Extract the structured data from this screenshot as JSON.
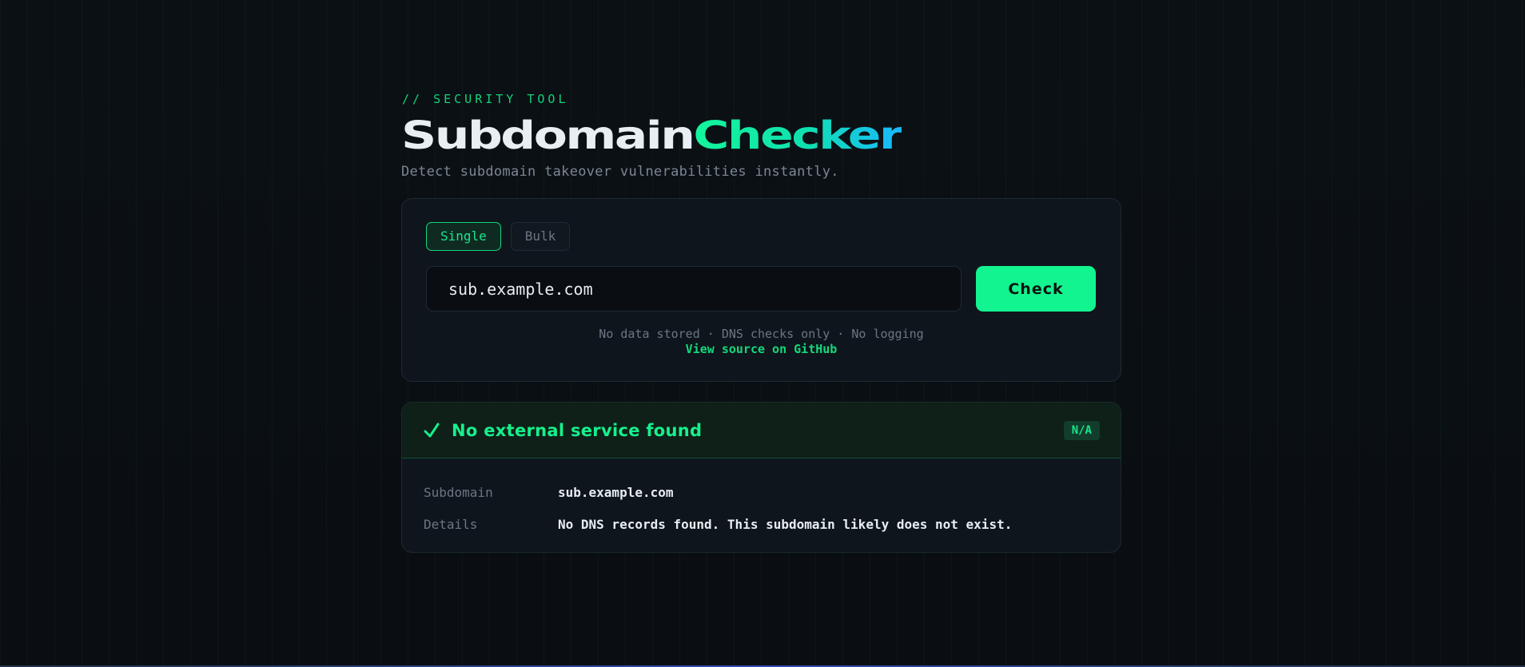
{
  "header": {
    "eyebrow": "// SECURITY TOOL",
    "title_part1": "Subdomain",
    "title_part2": "Checker",
    "subtitle": "Detect subdomain takeover vulnerabilities instantly."
  },
  "checker": {
    "tabs": [
      {
        "label": "Single",
        "active": true
      },
      {
        "label": "Bulk",
        "active": false
      }
    ],
    "input_value": "sub.example.com",
    "check_label": "Check",
    "meta_text": "No data stored · DNS checks only · No logging",
    "github_link": "View source on GitHub"
  },
  "result": {
    "status_icon": "checkmark-icon",
    "status_title": "No external service found",
    "badge": "N/A",
    "rows": [
      {
        "key": "Subdomain",
        "value": "sub.example.com"
      },
      {
        "key": "Details",
        "value": "No DNS records found. This subdomain likely does not exist."
      }
    ]
  },
  "colors": {
    "accent": "#12f490",
    "background": "#0a0e13",
    "card": "#0f151c",
    "muted": "#6b7684"
  }
}
